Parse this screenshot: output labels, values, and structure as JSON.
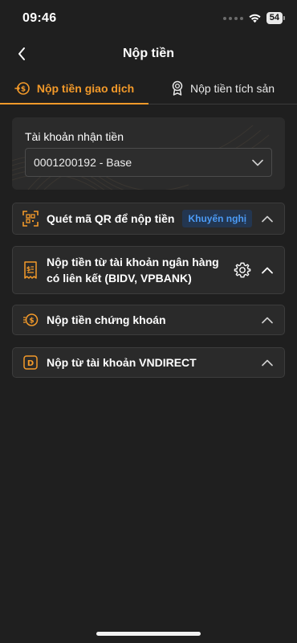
{
  "status_bar": {
    "time": "09:46",
    "battery": "54"
  },
  "header": {
    "title": "Nộp tiền"
  },
  "tabs": [
    {
      "label": "Nộp tiền giao dịch",
      "active": true
    },
    {
      "label": "Nộp tiền tích sản",
      "active": false
    }
  ],
  "account": {
    "label": "Tài khoản nhận tiền",
    "selected": "0001200192 - Base"
  },
  "sections": [
    {
      "title": "Quét mã QR để nộp tiền",
      "badge": "Khuyến nghị"
    },
    {
      "title": "Nộp tiền từ tài khoản ngân hàng có liên kết (BIDV, VPBANK)"
    },
    {
      "title": "Nộp tiền chứng khoán"
    },
    {
      "title": "Nộp từ tài khoản VNDIRECT"
    }
  ],
  "colors": {
    "accent": "#f39a2a",
    "badge_text": "#4c9bf5",
    "background": "#1f1f1f"
  }
}
